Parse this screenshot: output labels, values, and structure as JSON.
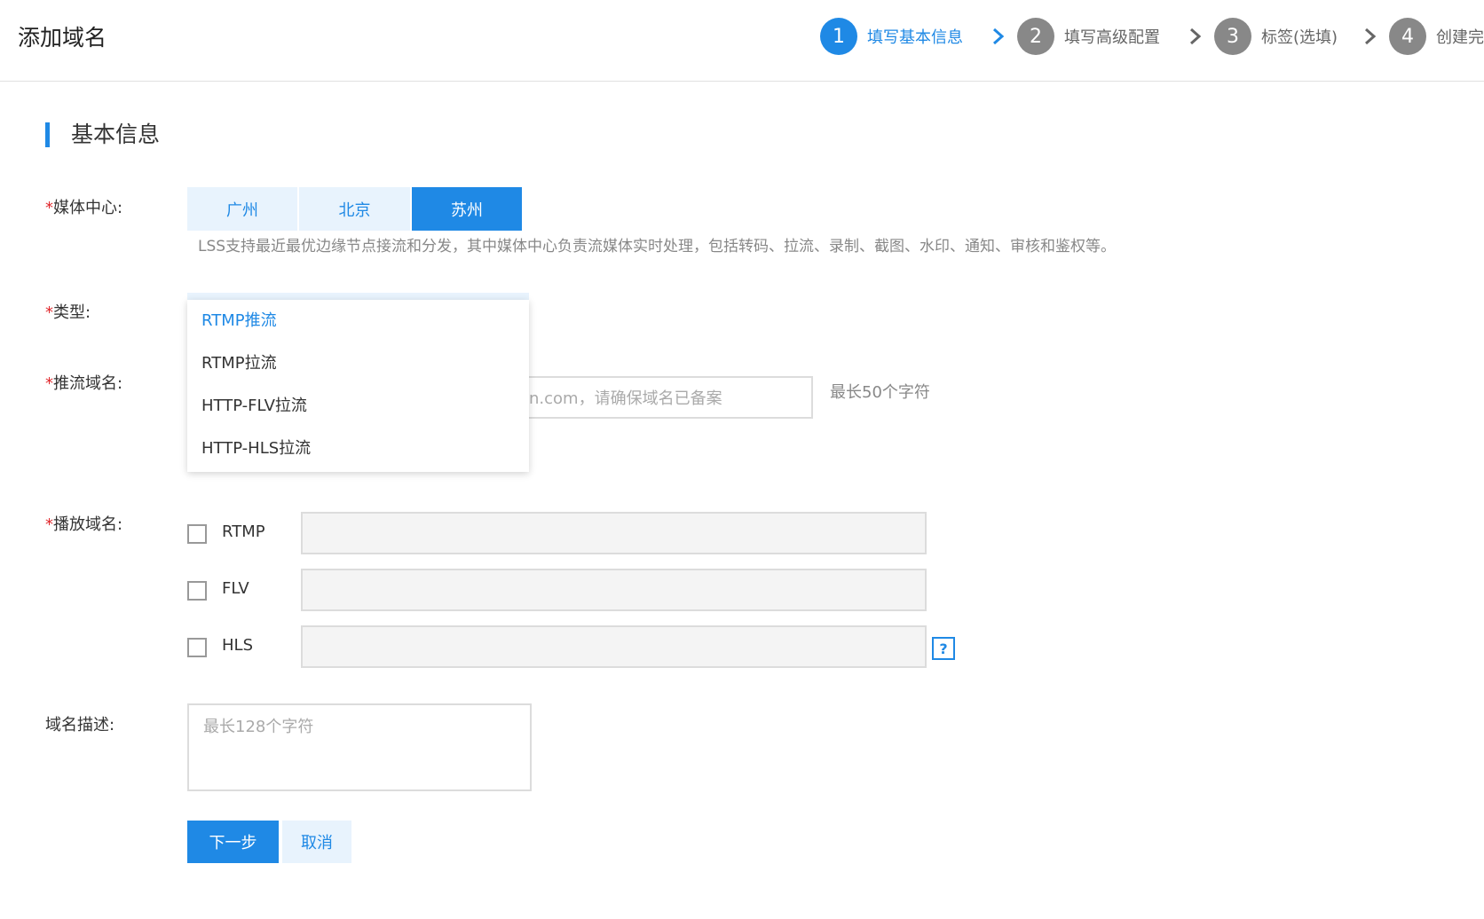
{
  "header": {
    "title": "添加域名",
    "steps": [
      {
        "num": "1",
        "label": "填写基本信息",
        "state": "active"
      },
      {
        "num": "2",
        "label": "填写高级配置",
        "state": "pending"
      },
      {
        "num": "3",
        "label": "标签(选填)",
        "state": "pending"
      },
      {
        "num": "4",
        "label": "创建完成",
        "state": "pending"
      }
    ]
  },
  "section": {
    "title": "基本信息"
  },
  "form": {
    "required_mark": "*",
    "media_center": {
      "label": "媒体中心:",
      "options": [
        "广州",
        "北京",
        "苏州"
      ],
      "selected": "苏州",
      "hint": "LSS支持最近最优边缘节点接流和分发，其中媒体中心负责流媒体实时处理，包括转码、拉流、录制、截图、水印、通知、审核和鉴权等。"
    },
    "type": {
      "label": "类型:",
      "dropdown_open": true,
      "current": "RTMP推流",
      "options": [
        "RTMP推流",
        "RTMP拉流",
        "HTTP-FLV拉流",
        "HTTP-HLS拉流"
      ]
    },
    "push_domain": {
      "label": "推流域名:",
      "placeholder_visible": "n.com，请确保域名已备案",
      "hint": "最长50个字符"
    },
    "play_domain": {
      "label": "播放域名:",
      "rows": [
        {
          "label": "RTMP",
          "checked": false,
          "value": ""
        },
        {
          "label": "FLV",
          "checked": false,
          "value": ""
        },
        {
          "label": "HLS",
          "checked": false,
          "value": ""
        }
      ],
      "help_icon": "?"
    },
    "description": {
      "label": "域名描述:",
      "placeholder": "最长128个字符"
    },
    "buttons": {
      "next": "下一步",
      "cancel": "取消"
    }
  },
  "colors": {
    "accent": "#1f89e5",
    "required": "#e0282d",
    "step_pending": "#888888",
    "segment_bg": "#e8f3fd"
  },
  "icons": {
    "step_separator": "chevron-right-icon",
    "help": "question-icon",
    "section_marker": "section-bar"
  }
}
